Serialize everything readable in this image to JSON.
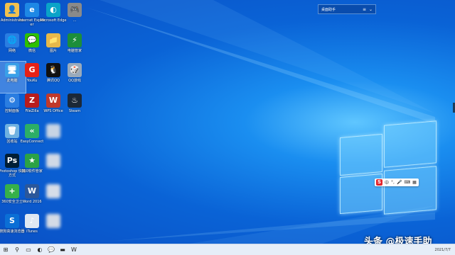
{
  "widget": {
    "title": "桌面助手",
    "list_icon": "≡",
    "dropdown_icon": "⌄"
  },
  "icons": [
    {
      "id": "icon-admin",
      "label": "Administrato",
      "color": "#f2c14e",
      "glyph": "👤",
      "blur": false
    },
    {
      "id": "icon-ie",
      "label": "Internet Explorer",
      "color": "#1e88e5",
      "glyph": "e",
      "blur": false
    },
    {
      "id": "icon-edge",
      "label": "Microsoft Edge",
      "color": "#0aa3c8",
      "glyph": "◐",
      "blur": false
    },
    {
      "id": "icon-game",
      "label": "...",
      "color": "#8a8a8a",
      "glyph": "🎮",
      "blur": false
    },
    {
      "id": "icon-network",
      "label": "网络",
      "color": "#2a7de1",
      "glyph": "🌐",
      "blur": false
    },
    {
      "id": "icon-wechat",
      "label": "微信",
      "color": "#2dc100",
      "glyph": "💬",
      "blur": false
    },
    {
      "id": "icon-folder",
      "label": "图片",
      "color": "#e6b84a",
      "glyph": "📁",
      "blur": false
    },
    {
      "id": "icon-pc-manager",
      "label": "电脑管家",
      "color": "#1c8e3a",
      "glyph": "⚡",
      "blur": false
    },
    {
      "id": "icon-computer",
      "label": "此电脑",
      "color": "#3aa0e8",
      "glyph": "🖥",
      "blur": false,
      "selected": true
    },
    {
      "id": "icon-youku",
      "label": "YouKu",
      "color": "#e62117",
      "glyph": "G",
      "blur": false
    },
    {
      "id": "icon-qq",
      "label": "腾讯QQ",
      "color": "#111",
      "glyph": "🐧",
      "blur": false
    },
    {
      "id": "icon-qqgame",
      "label": "QQ游戏",
      "color": "#9ab",
      "glyph": "🎲",
      "blur": false
    },
    {
      "id": "icon-control",
      "label": "控制面板",
      "color": "#2a7de1",
      "glyph": "⚙",
      "blur": false
    },
    {
      "id": "icon-filezilla",
      "label": "FileZilla",
      "color": "#b81c1c",
      "glyph": "Z",
      "blur": false
    },
    {
      "id": "icon-wps",
      "label": "WPS Office",
      "color": "#c0392b",
      "glyph": "W",
      "blur": false
    },
    {
      "id": "icon-steam",
      "label": "Steam",
      "color": "#1b2838",
      "glyph": "♨",
      "blur": false
    },
    {
      "id": "icon-recycle",
      "label": "回收站",
      "color": "#6fb1e0",
      "glyph": "🗑",
      "blur": false
    },
    {
      "id": "icon-easy",
      "label": "EasyConnect",
      "color": "#2cae66",
      "glyph": "«",
      "blur": false
    },
    {
      "id": "icon-blur1",
      "label": "",
      "color": "#c7d4e4",
      "glyph": "",
      "blur": true
    },
    {
      "id": "icon-ps",
      "label": "Photoshop 快捷方式",
      "color": "#001e36",
      "glyph": "Ps",
      "blur": false
    },
    {
      "id": "icon-360",
      "label": "360软件管家",
      "color": "#2ba245",
      "glyph": "★",
      "blur": false
    },
    {
      "id": "icon-blur2",
      "label": "",
      "color": "#d0d9e6",
      "glyph": "",
      "blur": true
    },
    {
      "id": "icon-360safe",
      "label": "360安全卫士",
      "color": "#36b04a",
      "glyph": "+",
      "blur": false
    },
    {
      "id": "icon-word",
      "label": "Word 2016",
      "color": "#2b579a",
      "glyph": "W",
      "blur": false
    },
    {
      "id": "icon-blur3",
      "label": "",
      "color": "#d6dde8",
      "glyph": "",
      "blur": true
    },
    {
      "id": "icon-sogou",
      "label": "搜狗高速浏览器",
      "color": "#0b6fd6",
      "glyph": "S",
      "blur": false
    },
    {
      "id": "icon-itunes",
      "label": "iTunes",
      "color": "#e0e8f2",
      "glyph": "♪",
      "blur": false
    },
    {
      "id": "icon-blur4",
      "label": "",
      "color": "#d3dbe6",
      "glyph": "",
      "blur": true
    }
  ],
  "ime": {
    "logo": "S",
    "mode": "中",
    "punct": "°,",
    "mic": "🎤",
    "kbd": "⌨",
    "grid": "▦"
  },
  "taskbar": {
    "items": [
      {
        "name": "start-button",
        "glyph": "⊞"
      },
      {
        "name": "search-button",
        "glyph": "⚲"
      },
      {
        "name": "task-view-button",
        "glyph": "▭"
      },
      {
        "name": "taskbar-edge",
        "glyph": "◐"
      },
      {
        "name": "taskbar-wechat",
        "glyph": "💬"
      },
      {
        "name": "taskbar-folder",
        "glyph": "▬"
      },
      {
        "name": "taskbar-word",
        "glyph": "W"
      }
    ],
    "clock_date": "2021/7/7"
  },
  "watermark": "头条 @极速手助"
}
